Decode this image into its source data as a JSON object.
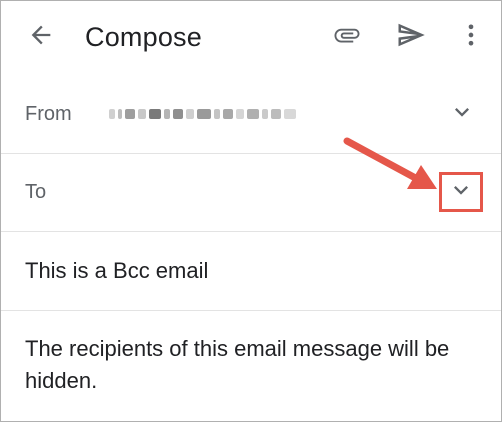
{
  "appbar": {
    "title": "Compose",
    "back_icon": "arrow-back-icon",
    "attach_icon": "paperclip-icon",
    "send_icon": "send-icon",
    "more_icon": "more-vert-icon"
  },
  "from": {
    "label": "From",
    "chevron_icon": "chevron-down-icon"
  },
  "to": {
    "label": "To",
    "chevron_icon": "chevron-down-icon"
  },
  "subject": {
    "value": "This is a Bcc email"
  },
  "body": {
    "value": "The recipients of this email message will be hidden."
  },
  "colors": {
    "icon": "#5f6368",
    "text": "#202124",
    "annotation": "#e5574a",
    "divider": "#e3e3e3"
  }
}
